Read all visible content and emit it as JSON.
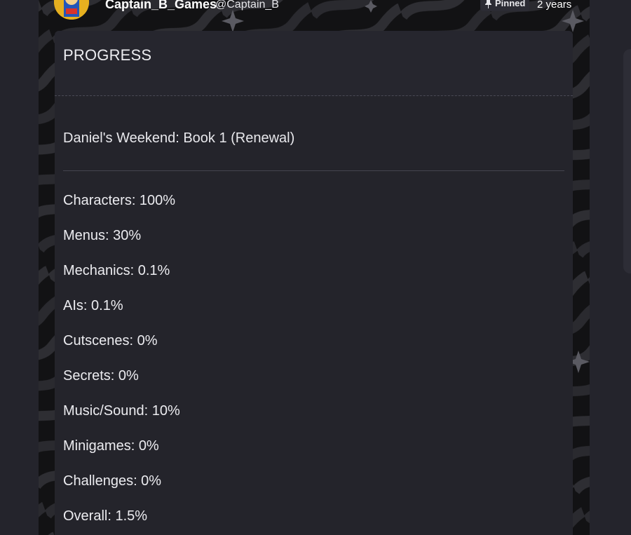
{
  "post": {
    "username": "Captain_B_Games",
    "handle": "@Captain_B",
    "pinned_label": "Pinned",
    "time_ago": "2 years"
  },
  "card": {
    "title": "PROGRESS",
    "subtitle": "Daniel's Weekend: Book 1 (Renewal)",
    "items": [
      {
        "text": "Characters: 100%"
      },
      {
        "text": "Menus: 30%"
      },
      {
        "text": "Mechanics: 0.1%"
      },
      {
        "text": "AIs: 0.1%"
      },
      {
        "text": "Cutscenes: 0%"
      },
      {
        "text": "Secrets: 0%"
      },
      {
        "text": "Music/Sound: 10%"
      },
      {
        "text": "Minigames: 0%"
      },
      {
        "text": "Challenges: 0%"
      },
      {
        "text": "Overall: 1.5%"
      }
    ]
  },
  "icons": {
    "pin": "pin-icon",
    "avatar": "avatar"
  },
  "colors": {
    "page_background": "#24242c",
    "card_background": "#24242b",
    "text": "#ececf0"
  }
}
